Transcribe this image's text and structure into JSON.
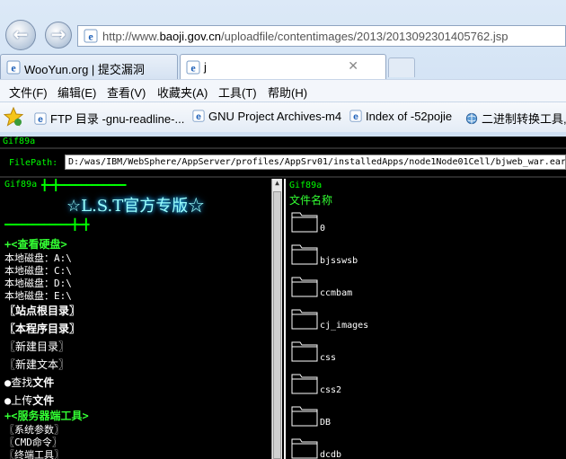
{
  "browser": {
    "address_url_prefix": "http://www.",
    "address_url_host": "baoji.gov.cn",
    "address_url_rest": "/uploadfile/contentimages/2013/2013092301405762.jsp",
    "tabs": [
      {
        "label": "WooYun.org | 提交漏洞"
      },
      {
        "label": "j"
      }
    ],
    "tab_close": "✕",
    "back_glyph": "←",
    "forward_glyph": "→",
    "menu": [
      "文件(F)",
      "编辑(E)",
      "查看(V)",
      "收藏夹(A)",
      "工具(T)",
      "帮助(H)"
    ],
    "favorites": [
      {
        "label": "FTP 目录 -gnu-readline-..."
      },
      {
        "label": "GNU Project Archives-m4"
      },
      {
        "label": "Index of -52pojie"
      },
      {
        "label": "二进制转换工具,/"
      }
    ],
    "colors": {
      "ie_blue": "#1c5fb8",
      "chrome_bg": "#dce9f7"
    }
  },
  "page": {
    "gif_top": "Gif89a",
    "filepath_label": "FilePath:",
    "filepath_value": "D:/was/IBM/WebSphere/AppServer/profiles/AppSrv01/installedApps/node1Node01Cell/bjweb_war.ear/",
    "left": {
      "gif": "Gif89a",
      "banner_top": "╋━╋━━━━━━━━━━━━",
      "title": "☆L.S.T官方专版☆",
      "banner_bottom": "━━━━━━━━━━━━╋━╋",
      "disk_section": "+<查看硬盘>",
      "disks": [
        "本地磁盘：A:\\",
        "本地磁盘：C:\\",
        "本地磁盘：D:\\",
        "本地磁盘：E:\\"
      ],
      "site_root": "〖站点根目录〗",
      "prog_dir": "〖本程序目录〗",
      "new_dir": "〖新建目录〗",
      "new_text": "〖新建文本〗",
      "find_file_prefix": "●查找",
      "find_file_bold": "文件",
      "upload_prefix": "●上传",
      "upload_bold": "文件",
      "server_section": "+<服务器端工具>",
      "sys_params": "〖系统参数〗",
      "cmd": "〖CMD命令〗",
      "terminal": "〖终端工具〗"
    },
    "right": {
      "gif": "Gif89a",
      "column": "文件名称",
      "folders": [
        "0",
        "bjsswsb",
        "ccmbam",
        "cj_images",
        "css",
        "css2",
        "DB",
        "dcdb"
      ]
    },
    "colors": {
      "accent_green": "#00ff00",
      "bg": "#000000",
      "title_glow": "#99ffff"
    }
  }
}
